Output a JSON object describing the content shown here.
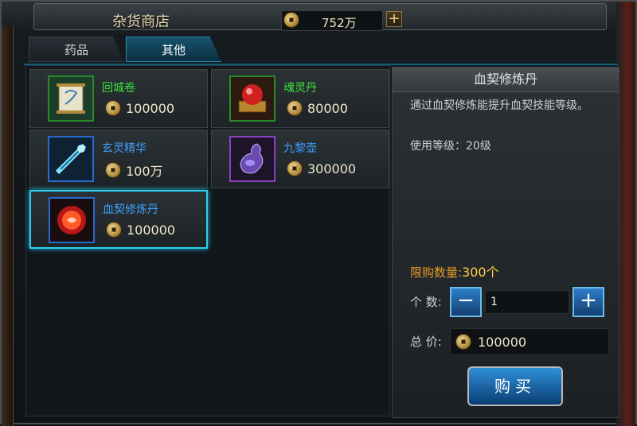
{
  "shop": {
    "title": "杂货商店",
    "currency": {
      "value": "752万",
      "icon": "copper-coin-icon"
    },
    "add_currency_icon": "plus-icon"
  },
  "tabs": [
    {
      "label": "药品",
      "active": false
    },
    {
      "label": "其他",
      "active": true
    }
  ],
  "items": [
    {
      "name": "回城卷",
      "price": "100000",
      "name_color": "#39e23b",
      "icon": "scroll-icon"
    },
    {
      "name": "魂灵丹",
      "price": "80000",
      "name_color": "#39e23b",
      "icon": "red-orb-icon"
    },
    {
      "name": "玄灵精华",
      "price": "100万",
      "name_color": "#3fa0ff",
      "icon": "crystal-essence-icon"
    },
    {
      "name": "九黎壶",
      "price": "300000",
      "name_color": "#3fa0ff",
      "icon": "purple-vase-icon"
    },
    {
      "name": "血契修炼丹",
      "price": "100000",
      "name_color": "#3fa0ff",
      "icon": "red-pill-icon",
      "selected": true
    }
  ],
  "detail": {
    "title": "血契修炼丹",
    "description": "通过血契修炼能提升血契技能等级。",
    "level": "使用等级：20级",
    "limit_label": "限购数量:",
    "limit_value": "300个",
    "quantity_label": "个 数:",
    "quantity_value": "1",
    "total_label": "总 价:",
    "total_value": "100000",
    "buy_label": "购买"
  },
  "colors": {
    "accent": "#2dd0f0",
    "green_name": "#39e23b",
    "blue_name": "#3fa0ff",
    "limit": "#e89b2a"
  }
}
